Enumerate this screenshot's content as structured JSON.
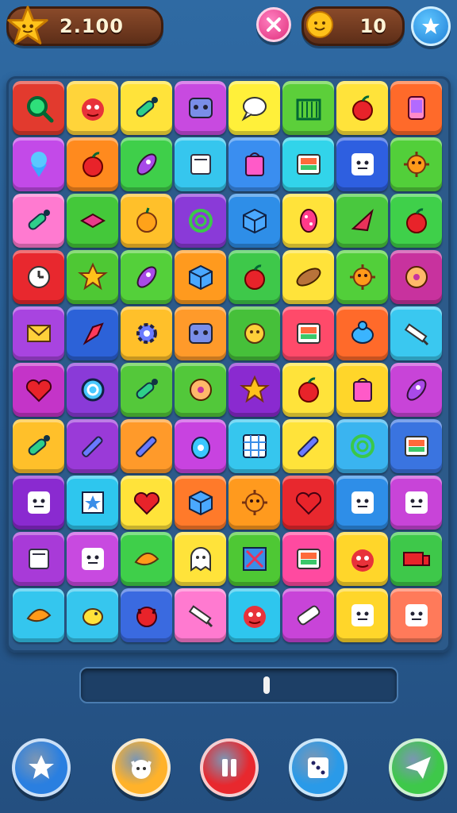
{
  "hud": {
    "score": "2.100",
    "lives": "10",
    "close_icon": "close-icon",
    "favorite_icon": "star-icon"
  },
  "board": {
    "rows": 10,
    "cols": 8,
    "tiles": [
      [
        "#e23a2e",
        "magnifier"
      ],
      [
        "#ffd43a",
        "monster"
      ],
      [
        "#ffe33a",
        "bottle"
      ],
      [
        "#c84ae0",
        "robot"
      ],
      [
        "#fff03a",
        "bubble"
      ],
      [
        "#5ccf3a",
        "building"
      ],
      [
        "#ffe33a",
        "apple"
      ],
      [
        "#ff6a2a",
        "phone"
      ],
      [
        "#c34ae8",
        "icecream"
      ],
      [
        "#ff8a1e",
        "apple"
      ],
      [
        "#3fcf4a",
        "rocket"
      ],
      [
        "#36c6ee",
        "box"
      ],
      [
        "#3a8ef0",
        "bag"
      ],
      [
        "#32d4ea",
        "screen"
      ],
      [
        "#2e5fe0",
        "face"
      ],
      [
        "#52cf3a",
        "virus"
      ],
      [
        "#ff7ad0",
        "bottle"
      ],
      [
        "#44c83a",
        "gem"
      ],
      [
        "#ffc02a",
        "fruit"
      ],
      [
        "#8a3ad8",
        "swirl"
      ],
      [
        "#2e8ee8",
        "cube"
      ],
      [
        "#ffe33a",
        "seed"
      ],
      [
        "#49c83e",
        "cone"
      ],
      [
        "#3fd04a",
        "apple"
      ],
      [
        "#e8282e",
        "clock"
      ],
      [
        "#4ec834",
        "star"
      ],
      [
        "#54d03a",
        "rocket"
      ],
      [
        "#ff9a1e",
        "cube"
      ],
      [
        "#3ec84a",
        "apple"
      ],
      [
        "#ffe33a",
        "sausage"
      ],
      [
        "#52cf3a",
        "virus"
      ],
      [
        "#c8329e",
        "donut"
      ],
      [
        "#a844e0",
        "envelope"
      ],
      [
        "#2c62d8",
        "flag"
      ],
      [
        "#ffc02a",
        "gear"
      ],
      [
        "#ff9a2a",
        "robot"
      ],
      [
        "#46c03a",
        "moon"
      ],
      [
        "#ff4a6a",
        "screen"
      ],
      [
        "#ff6a2a",
        "turtle"
      ],
      [
        "#3ac8f0",
        "pencil"
      ],
      [
        "#c434c8",
        "heart"
      ],
      [
        "#8a3ad8",
        "coin"
      ],
      [
        "#54c83a",
        "bottle"
      ],
      [
        "#52c83a",
        "donut"
      ],
      [
        "#8a2ad0",
        "star"
      ],
      [
        "#ffe33a",
        "apple"
      ],
      [
        "#ffd62a",
        "bag"
      ],
      [
        "#c844d8",
        "rocket"
      ],
      [
        "#ffc02a",
        "bottle"
      ],
      [
        "#9a3ad8",
        "crayon"
      ],
      [
        "#ff9a2a",
        "crayon"
      ],
      [
        "#c843e0",
        "drop"
      ],
      [
        "#36c6ee",
        "grid"
      ],
      [
        "#ffe33a",
        "crayon"
      ],
      [
        "#3ab4f0",
        "swirl"
      ],
      [
        "#3a74e0",
        "screen"
      ],
      [
        "#8a2ad0",
        "face"
      ],
      [
        "#2ec6ee",
        "card"
      ],
      [
        "#ffe33a",
        "heart"
      ],
      [
        "#ff7a2a",
        "cube"
      ],
      [
        "#ff9a1e",
        "virus"
      ],
      [
        "#e8282e",
        "heart"
      ],
      [
        "#2e8ee8",
        "face"
      ],
      [
        "#c844d8",
        "face"
      ],
      [
        "#a83ad8",
        "box"
      ],
      [
        "#c84ae0",
        "face"
      ],
      [
        "#3fcf4a",
        "leaf"
      ],
      [
        "#ffe33a",
        "ghost"
      ],
      [
        "#4ec834",
        "square"
      ],
      [
        "#ff4aa0",
        "screen"
      ],
      [
        "#ffd62a",
        "monster"
      ],
      [
        "#3ec84a",
        "truck"
      ],
      [
        "#34c6ee",
        "leaf"
      ],
      [
        "#36c6ee",
        "bird"
      ],
      [
        "#3a6ae0",
        "cat"
      ],
      [
        "#ff7ad0",
        "pencil"
      ],
      [
        "#2ec6ee",
        "monster"
      ],
      [
        "#c844d8",
        "candy"
      ],
      [
        "#ffd62a",
        "face"
      ],
      [
        "#ff7a5a",
        "face"
      ]
    ]
  },
  "progress": {
    "level": 0.59
  },
  "bottom_bar": [
    {
      "name": "star-button",
      "icon": "star-icon",
      "color": "#2a7fe0"
    },
    {
      "name": "pet-button",
      "icon": "cat-face-icon",
      "color": "#ffb22a"
    },
    {
      "name": "pause-button",
      "icon": "pause-icon",
      "color": "#e8282e"
    },
    {
      "name": "dice-button",
      "icon": "dice-icon",
      "color": "#2a9ae8"
    },
    {
      "name": "send-button",
      "icon": "paper-plane-icon",
      "color": "#3ec84a"
    }
  ]
}
